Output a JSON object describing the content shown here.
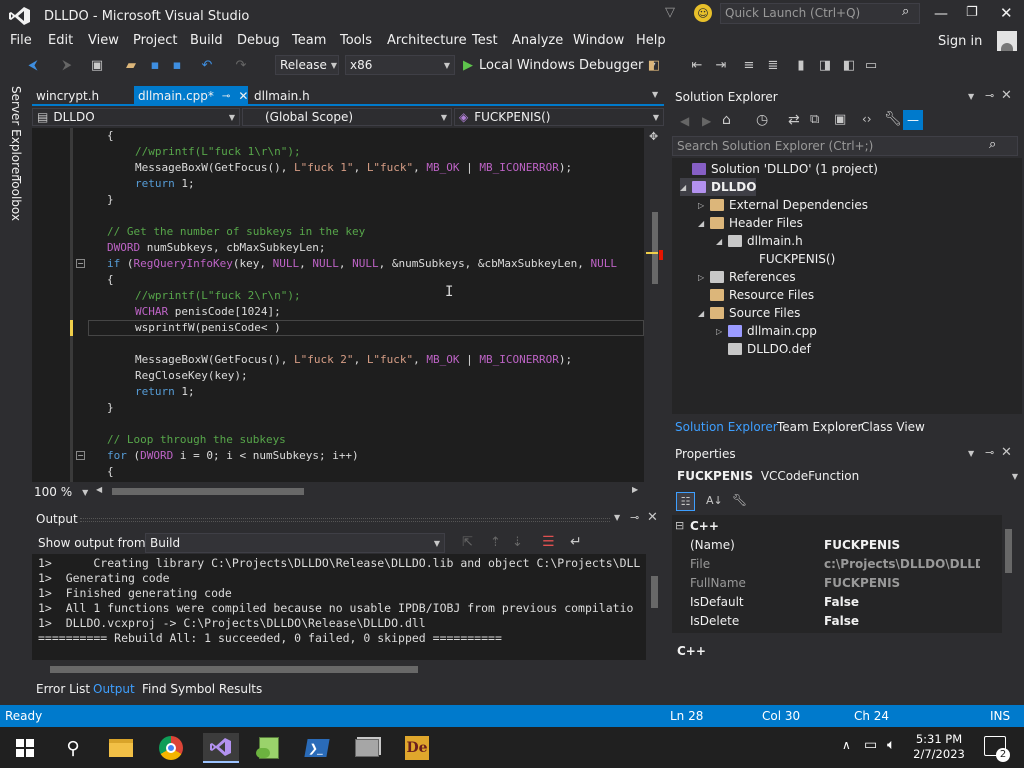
{
  "window": {
    "title": "DLLDO - Microsoft Visual Studio",
    "quick_launch_placeholder": "Quick Launch (Ctrl+Q)",
    "sign_in": "Sign in"
  },
  "menu": [
    "File",
    "Edit",
    "View",
    "Project",
    "Build",
    "Debug",
    "Team",
    "Tools",
    "Architecture",
    "Test",
    "Analyze",
    "Window",
    "Help"
  ],
  "toolbar": {
    "configuration": "Release",
    "platform": "x86",
    "run_label": "Local Windows Debugger"
  },
  "tabs": [
    {
      "label": "wincrypt.h"
    },
    {
      "label": "dllmain.cpp*"
    },
    {
      "label": "dllmain.h"
    }
  ],
  "navbar": {
    "project": "DLLDO",
    "scope": "(Global Scope)",
    "member": "FUCKPENIS()"
  },
  "left_sidebar": {
    "server_explorer": "Server Explorer",
    "toolbox": "Toolbox"
  },
  "code_lines": [
    {
      "parts": [
        [
          "{",
          ""
        ]
      ],
      "indent": 2
    },
    {
      "parts": [
        [
          "//wprintf(L\"fuck 1\\r\\n\");",
          "cm"
        ]
      ],
      "indent": 3
    },
    {
      "parts": [
        [
          "MessageBoxW(GetFocus(), ",
          ""
        ],
        [
          "L\"fuck 1\"",
          "st"
        ],
        [
          ", ",
          ""
        ],
        [
          "L\"fuck\"",
          "st"
        ],
        [
          ", ",
          ""
        ],
        [
          "MB_OK",
          "mc"
        ],
        [
          " | ",
          ""
        ],
        [
          "MB_ICONERROR",
          "mc"
        ],
        [
          ");",
          ""
        ]
      ],
      "indent": 3
    },
    {
      "parts": [
        [
          "return",
          "kw"
        ],
        [
          " 1;",
          ""
        ]
      ],
      "indent": 3
    },
    {
      "parts": [
        [
          "}",
          ""
        ]
      ],
      "indent": 2
    },
    {
      "parts": [],
      "indent": 0
    },
    {
      "parts": [
        [
          "// Get the number of subkeys in the key",
          "cm"
        ]
      ],
      "indent": 2
    },
    {
      "parts": [
        [
          "DWORD",
          "mc"
        ],
        [
          " numSubkeys, cbMaxSubkeyLen;",
          ""
        ]
      ],
      "indent": 2
    },
    {
      "parts": [
        [
          "if",
          "kw"
        ],
        [
          " (",
          ""
        ],
        [
          "RegQueryInfoKey",
          "mc"
        ],
        [
          "(key, ",
          ""
        ],
        [
          "NULL",
          "mc"
        ],
        [
          ", ",
          ""
        ],
        [
          "NULL",
          "mc"
        ],
        [
          ", ",
          ""
        ],
        [
          "NULL",
          "mc"
        ],
        [
          ", &numSubkeys, &cbMaxSubkeyLen, ",
          ""
        ],
        [
          "NULL",
          "mc"
        ]
      ],
      "indent": 2
    },
    {
      "parts": [
        [
          "{",
          ""
        ]
      ],
      "indent": 2
    },
    {
      "parts": [
        [
          "//wprintf(L\"fuck 2\\r\\n\");",
          "cm"
        ]
      ],
      "indent": 3
    },
    {
      "parts": [
        [
          "WCHAR",
          "mc"
        ],
        [
          " penisCode[1024];",
          ""
        ]
      ],
      "indent": 3
    },
    {
      "parts": [
        [
          "wsprintfW(penisCode< )",
          ""
        ]
      ],
      "indent": 3
    },
    {
      "parts": [],
      "indent": 0
    },
    {
      "parts": [
        [
          "MessageBoxW(GetFocus(), ",
          ""
        ],
        [
          "L\"fuck 2\"",
          "st"
        ],
        [
          ", ",
          ""
        ],
        [
          "L\"fuck\"",
          "st"
        ],
        [
          ", ",
          ""
        ],
        [
          "MB_OK",
          "mc"
        ],
        [
          " | ",
          ""
        ],
        [
          "MB_ICONERROR",
          "mc"
        ],
        [
          ");",
          ""
        ]
      ],
      "indent": 3
    },
    {
      "parts": [
        [
          "RegCloseKey(key);",
          ""
        ]
      ],
      "indent": 3
    },
    {
      "parts": [
        [
          "return",
          "kw"
        ],
        [
          " 1;",
          ""
        ]
      ],
      "indent": 3
    },
    {
      "parts": [
        [
          "}",
          ""
        ]
      ],
      "indent": 2
    },
    {
      "parts": [],
      "indent": 0
    },
    {
      "parts": [
        [
          "// Loop through the subkeys",
          "cm"
        ]
      ],
      "indent": 2
    },
    {
      "parts": [
        [
          "for",
          "kw"
        ],
        [
          " (",
          ""
        ],
        [
          "DWORD",
          "mc"
        ],
        [
          " i = 0; i < numSubkeys; i++)",
          ""
        ]
      ],
      "indent": 2
    },
    {
      "parts": [
        [
          "{",
          ""
        ]
      ],
      "indent": 2
    }
  ],
  "editor": {
    "zoom": "100 %"
  },
  "solution_explorer": {
    "title": "Solution Explorer",
    "search_placeholder": "Search Solution Explorer (Ctrl+;)",
    "tree": [
      {
        "label": "Solution 'DLLDO' (1 project)",
        "level": 0,
        "arrow": "",
        "icon": "solution"
      },
      {
        "label": "DLLDO",
        "level": 0,
        "arrow": "open",
        "icon": "project",
        "bold": true
      },
      {
        "label": "External Dependencies",
        "level": 1,
        "arrow": "closed",
        "icon": "folder"
      },
      {
        "label": "Header Files",
        "level": 1,
        "arrow": "open",
        "icon": "folder"
      },
      {
        "label": "dllmain.h",
        "level": 2,
        "arrow": "open",
        "icon": "header"
      },
      {
        "label": "FUCKPENIS()",
        "level": 3,
        "arrow": "",
        "icon": "method"
      },
      {
        "label": "References",
        "level": 1,
        "arrow": "closed",
        "icon": "refs"
      },
      {
        "label": "Resource Files",
        "level": 1,
        "arrow": "",
        "icon": "folder"
      },
      {
        "label": "Source Files",
        "level": 1,
        "arrow": "open",
        "icon": "folder"
      },
      {
        "label": "dllmain.cpp",
        "level": 2,
        "arrow": "closed",
        "icon": "cpp"
      },
      {
        "label": "DLLDO.def",
        "level": 2,
        "arrow": "",
        "icon": "def"
      }
    ],
    "bottom_tabs": [
      "Solution Explorer",
      "Team Explorer",
      "Class View"
    ]
  },
  "properties": {
    "title": "Properties",
    "object_name": "FUCKPENIS",
    "object_type": "VCCodeFunction",
    "category": "C++",
    "rows": [
      {
        "name": "(Name)",
        "value": "FUCKPENIS"
      },
      {
        "name": "File",
        "value": "c:\\Projects\\DLLDO\\DLLDO\\d"
      },
      {
        "name": "FullName",
        "value": "FUCKPENIS"
      },
      {
        "name": "IsDefault",
        "value": "False"
      },
      {
        "name": "IsDelete",
        "value": "False"
      }
    ],
    "description": "C++"
  },
  "output": {
    "title": "Output",
    "show_from_label": "Show output from:",
    "source": "Build",
    "lines": [
      "1>      Creating library C:\\Projects\\DLLDO\\Release\\DLLDO.lib and object C:\\Projects\\DLL",
      "1>  Generating code",
      "1>  Finished generating code",
      "1>  All 1 functions were compiled because no usable IPDB/IOBJ from previous compilatio",
      "1>  DLLDO.vcxproj -> C:\\Projects\\DLLDO\\Release\\DLLDO.dll",
      "========== Rebuild All: 1 succeeded, 0 failed, 0 skipped =========="
    ],
    "bottom_tabs": [
      "Error List",
      "Output",
      "Find Symbol Results"
    ]
  },
  "status": {
    "state": "Ready",
    "line": "Ln 28",
    "col": "Col 30",
    "ch": "Ch 24",
    "mode": "INS"
  },
  "taskbar": {
    "time": "5:31 PM",
    "date": "2/7/2023",
    "notifications": "2"
  },
  "colors": {
    "accent": "#007acc",
    "bg": "#2d2d30",
    "editor_bg": "#1e1e1e",
    "vs_purple": "#865fc5"
  }
}
